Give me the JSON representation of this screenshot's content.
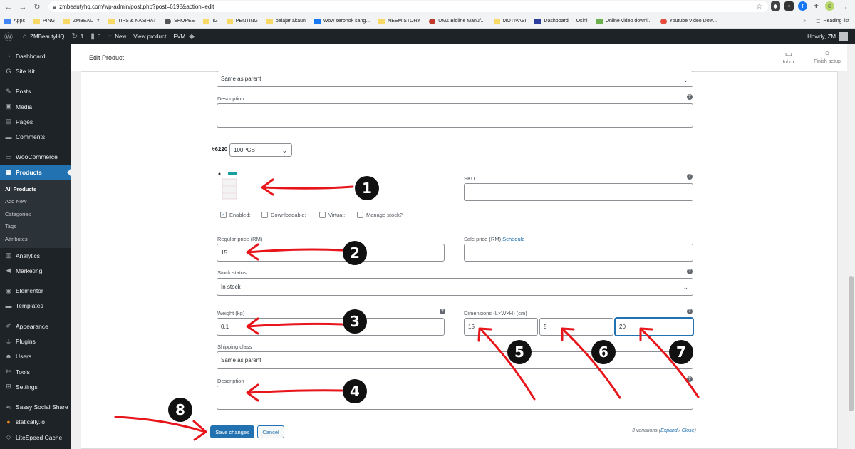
{
  "browser": {
    "url": "zmbeautyhq.com/wp-admin/post.php?post=6198&action=edit",
    "bookmarks": [
      "Apps",
      "PING",
      "ZMBEAUTY",
      "TIPS & NASIHAT",
      "SHOPEE",
      "IG",
      "PENTING",
      "belajar akaun",
      "Wow seronok sang...",
      "NEEM STORY",
      "UMZ Bioline Manuf...",
      "MOTIVASI",
      "Dashboard — Osini",
      "Online video downl...",
      "Youtube Video Dow..."
    ],
    "reading_list": "Reading list"
  },
  "adminbar": {
    "site": "ZMBeautyHQ",
    "updates": "1",
    "comments": "0",
    "new": "New",
    "view_product": "View product",
    "fvm": "FVM",
    "howdy": "Howdy, ZM"
  },
  "menu": {
    "items_top": [
      "Dashboard",
      "Site Kit"
    ],
    "items_mid": [
      "Posts",
      "Media",
      "Pages",
      "Comments"
    ],
    "woocommerce": "WooCommerce",
    "products": "Products",
    "products_sub": [
      "All Products",
      "Add New",
      "Categories",
      "Tags",
      "Attributes"
    ],
    "items_bottom1": [
      "Analytics",
      "Marketing"
    ],
    "items_bottom2": [
      "Elementor",
      "Templates"
    ],
    "items_bottom3": [
      "Appearance",
      "Plugins",
      "Users",
      "Tools",
      "Settings"
    ],
    "items_bottom4": [
      "Sassy Social Share",
      "statically.io",
      "LiteSpeed Cache"
    ]
  },
  "header": {
    "title": "Edit Product",
    "inbox": "Inbox",
    "finish_setup": "Finish setup"
  },
  "previous_variation": {
    "shipping_class_value": "Same as parent",
    "description_label": "Description"
  },
  "variation": {
    "id": "#6220",
    "option": "100PCS",
    "sku_label": "SKU",
    "sku_value": "",
    "enabled_label": "Enabled:",
    "downloadable_label": "Downloadable:",
    "virtual_label": "Virtual:",
    "manage_stock_label": "Manage stock?",
    "regular_price_label": "Regular price (RM)",
    "regular_price_value": "15",
    "sale_price_label": "Sale price (RM)",
    "schedule_link": "Schedule",
    "sale_price_value": "",
    "stock_status_label": "Stock status",
    "stock_status_value": "In stock",
    "weight_label": "Weight (kg)",
    "weight_value": "0.1",
    "dimensions_label": "Dimensions (L×W×H) (cm)",
    "length_value": "15",
    "width_value": "5",
    "height_value": "20",
    "shipping_class_label": "Shipping class",
    "shipping_class_value": "Same as parent",
    "description_label": "Description"
  },
  "footer": {
    "save_label": "Save changes",
    "cancel_label": "Cancel",
    "variations_count": "3 variations",
    "expand": "Expand",
    "close": "Close"
  },
  "annotations": [
    "1",
    "2",
    "3",
    "4",
    "5",
    "6",
    "7",
    "8"
  ],
  "colors": {
    "accent": "#2271b1",
    "admin_dark": "#1d2327",
    "annotation_red": "#e8151b"
  }
}
